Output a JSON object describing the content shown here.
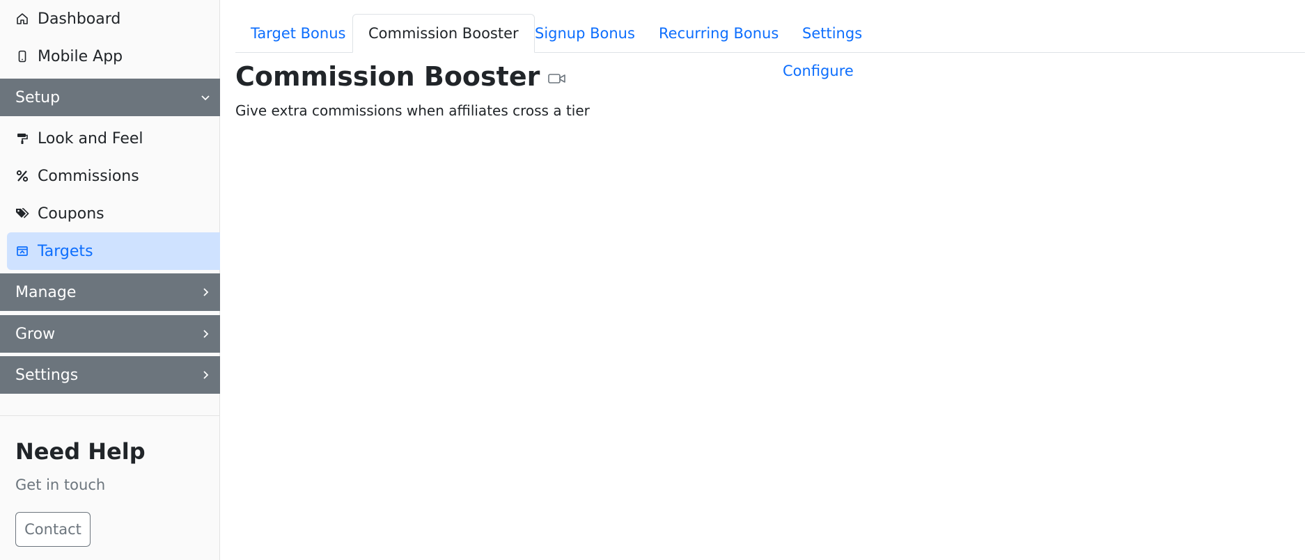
{
  "sidebar": {
    "top_items": [
      {
        "label": "Dashboard",
        "icon": "home-icon"
      },
      {
        "label": "Mobile App",
        "icon": "phone-icon"
      }
    ],
    "sections": [
      {
        "label": "Setup",
        "expanded": true
      },
      {
        "label": "Manage",
        "expanded": false
      },
      {
        "label": "Grow",
        "expanded": false
      },
      {
        "label": "Settings",
        "expanded": false
      }
    ],
    "setup_items": [
      {
        "label": "Look and Feel",
        "icon": "paint-roller-icon"
      },
      {
        "label": "Commissions",
        "icon": "percent-icon"
      },
      {
        "label": "Coupons",
        "icon": "tags-icon"
      },
      {
        "label": "Targets",
        "icon": "target-icon",
        "active": true
      }
    ],
    "help": {
      "title": "Need Help",
      "subtitle": "Get in touch",
      "button": "Contact"
    }
  },
  "tabs": [
    {
      "label": "Target Bonus"
    },
    {
      "label": "Commission Booster",
      "active": true
    },
    {
      "label": "Signup Bonus"
    },
    {
      "label": "Recurring Bonus"
    },
    {
      "label": "Settings"
    }
  ],
  "main": {
    "title": "Commission Booster",
    "title_icon": "video-icon",
    "configure_link": "Configure",
    "description": "Give extra commissions when affiliates cross a tier"
  },
  "colors": {
    "accent": "#0d6efd",
    "section_bg": "#6c757d",
    "active_bg": "#cfe2ff"
  }
}
